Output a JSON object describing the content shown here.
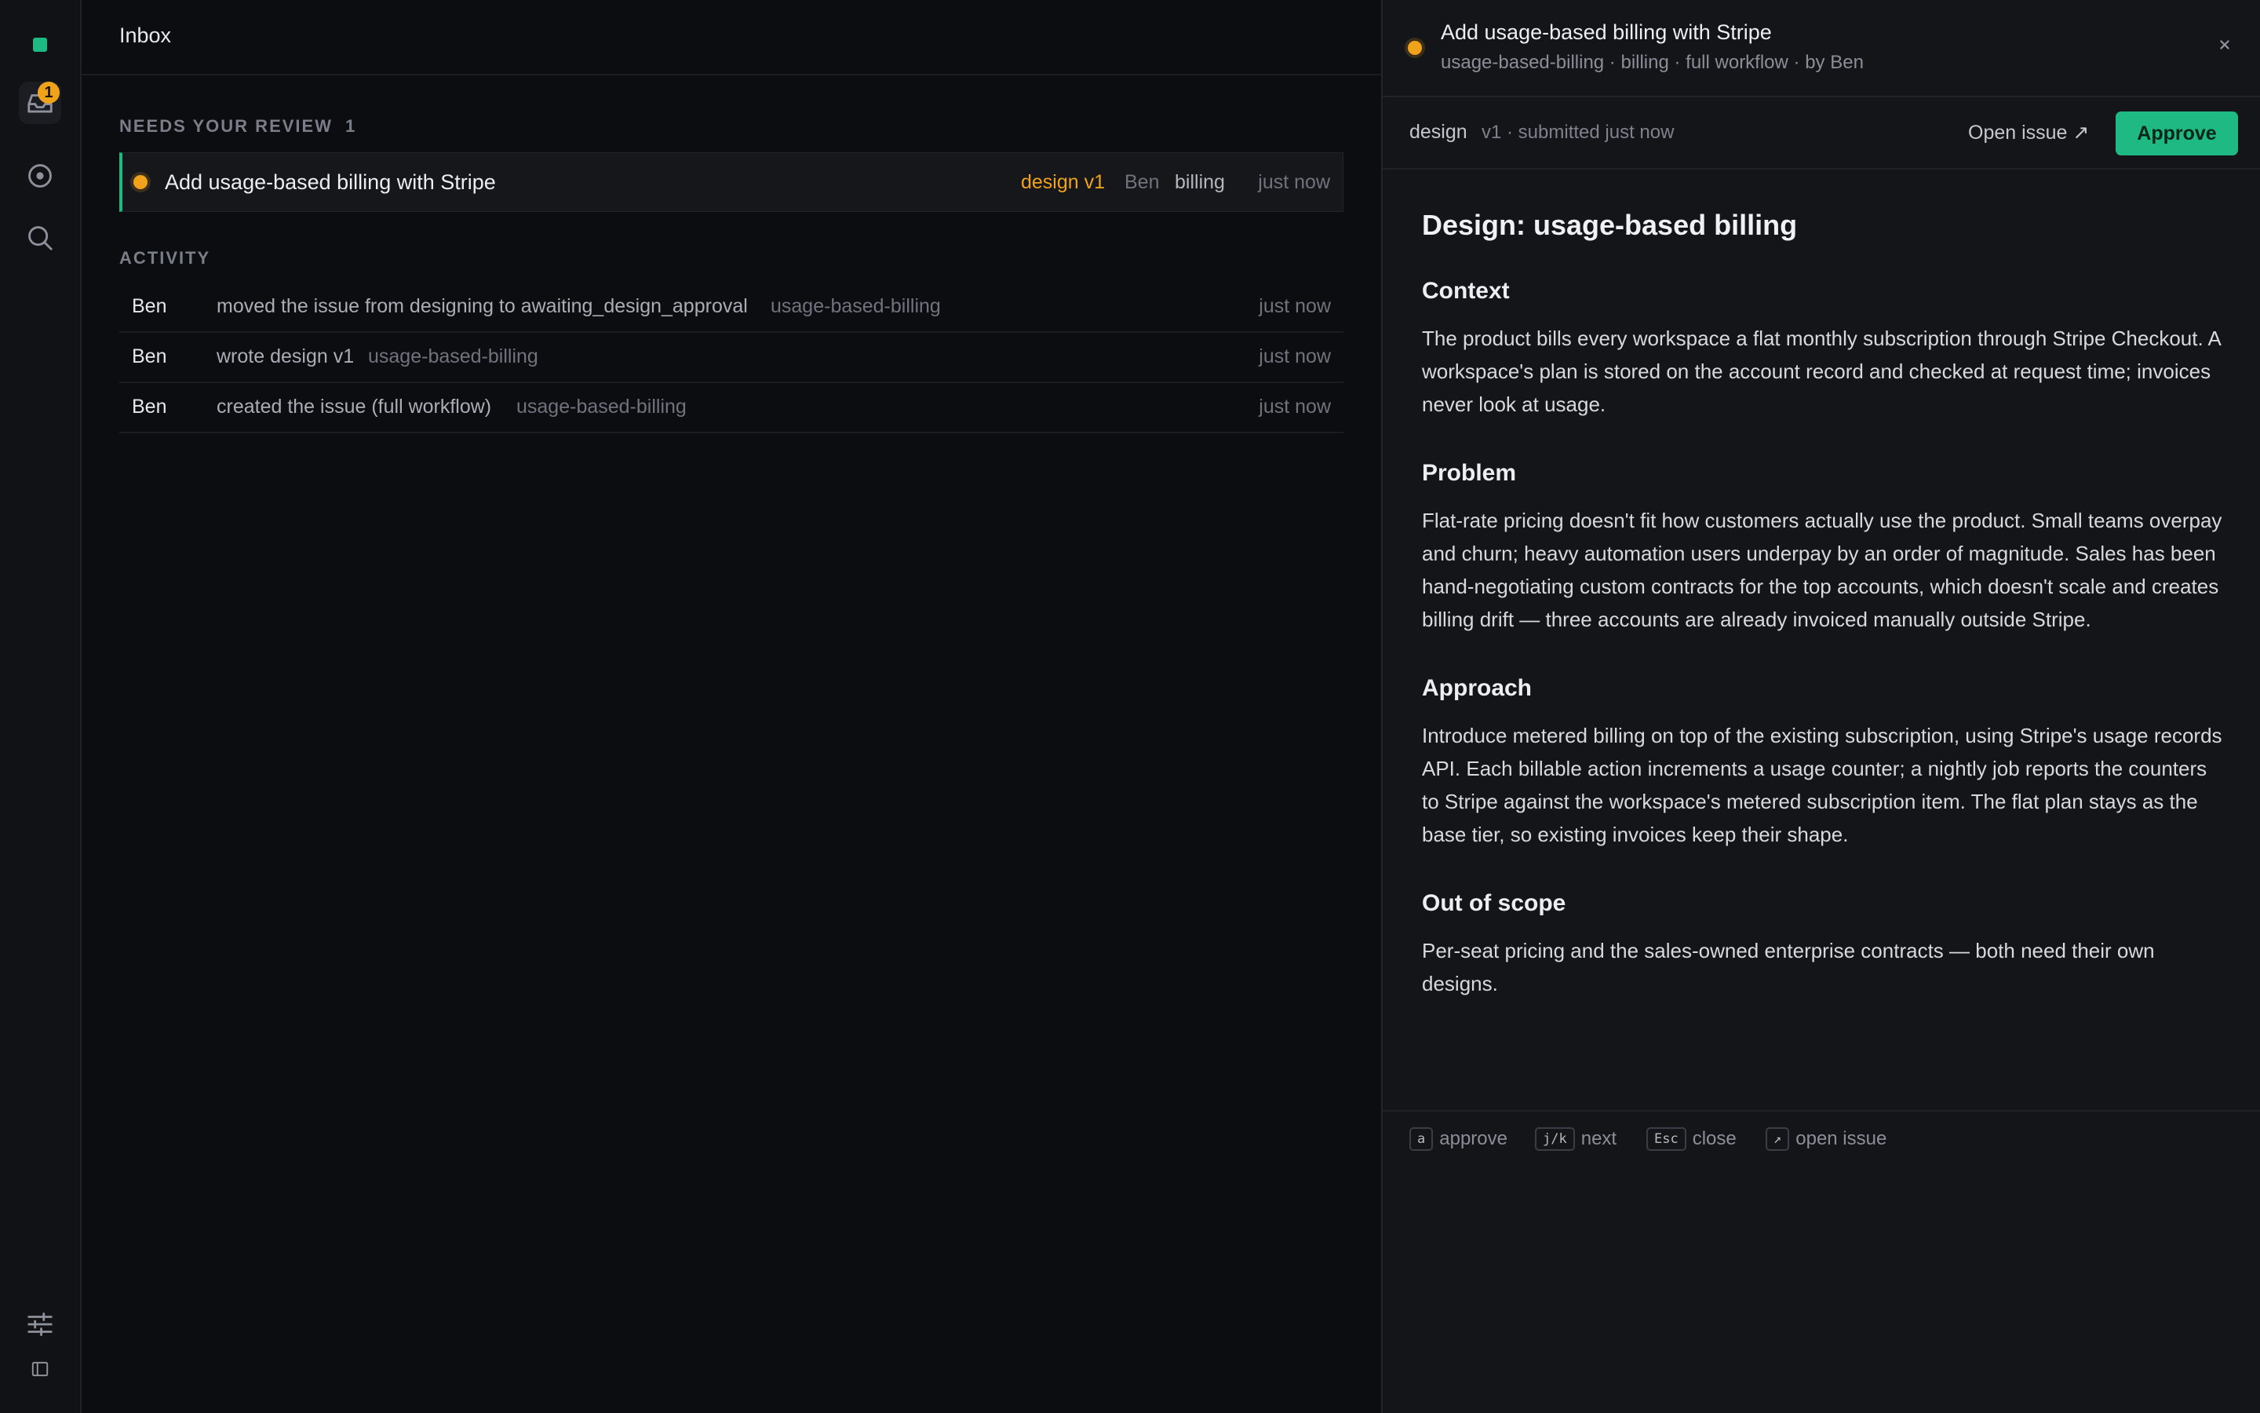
{
  "rail": {
    "inbox_badge": "1",
    "icons": [
      "logo-icon",
      "inbox-icon",
      "issues-icon",
      "search-icon",
      "settings-sliders-icon",
      "sidebar-toggle-icon"
    ]
  },
  "header": {
    "title": "Inbox"
  },
  "review": {
    "section_label": "NEEDS YOUR REVIEW",
    "count": "1",
    "item": {
      "title": "Add usage-based billing with Stripe",
      "stage": "design v1",
      "author": "Ben",
      "label": "billing",
      "time": "just now"
    }
  },
  "activity": {
    "section_label": "ACTIVITY",
    "rows": [
      {
        "who": "Ben",
        "what": "moved the issue from designing to awaiting_design_approval",
        "slug": "usage-based-billing",
        "time": "just now"
      },
      {
        "who": "Ben",
        "what": "wrote design v1",
        "slug": "usage-based-billing",
        "time": "just now"
      },
      {
        "who": "Ben",
        "what": "created the issue (full workflow)",
        "slug": "usage-based-billing",
        "time": "just now"
      }
    ]
  },
  "panel": {
    "title": "Add usage-based billing with Stripe",
    "subtitle": "usage-based-billing · billing · full workflow · by Ben",
    "doc_kind": "design",
    "doc_version": "v1 · submitted just now",
    "open_issue": "Open issue ↗",
    "approve": "Approve",
    "doc": {
      "title": "Design: usage-based billing",
      "sections": [
        {
          "heading": "Context",
          "body": "The product bills every workspace a flat monthly subscription through Stripe Checkout. A workspace's plan is stored on the account record and checked at request time; invoices never look at usage."
        },
        {
          "heading": "Problem",
          "body": "Flat-rate pricing doesn't fit how customers actually use the product. Small teams overpay and churn; heavy automation users underpay by an order of magnitude. Sales has been hand-negotiating custom contracts for the top accounts, which doesn't scale and creates billing drift — three accounts are already invoiced manually outside Stripe."
        },
        {
          "heading": "Approach",
          "body": "Introduce metered billing on top of the existing subscription, using Stripe's usage records API. Each billable action increments a usage counter; a nightly job reports the counters to Stripe against the workspace's metered subscription item. The flat plan stays as the base tier, so existing invoices keep their shape."
        },
        {
          "heading": "Out of scope",
          "body": "Per-seat pricing and the sales-owned enterprise contracts — both need their own designs."
        }
      ]
    },
    "hints": [
      {
        "key": "a",
        "label": "approve"
      },
      {
        "key": "j/k",
        "label": "next"
      },
      {
        "key": "Esc",
        "label": "close"
      },
      {
        "key": "↗",
        "label": "open issue"
      }
    ]
  },
  "colors": {
    "accent": "#1fb984",
    "warning": "#f0a21a",
    "background": "#0c0d10",
    "panel": "#141518"
  }
}
